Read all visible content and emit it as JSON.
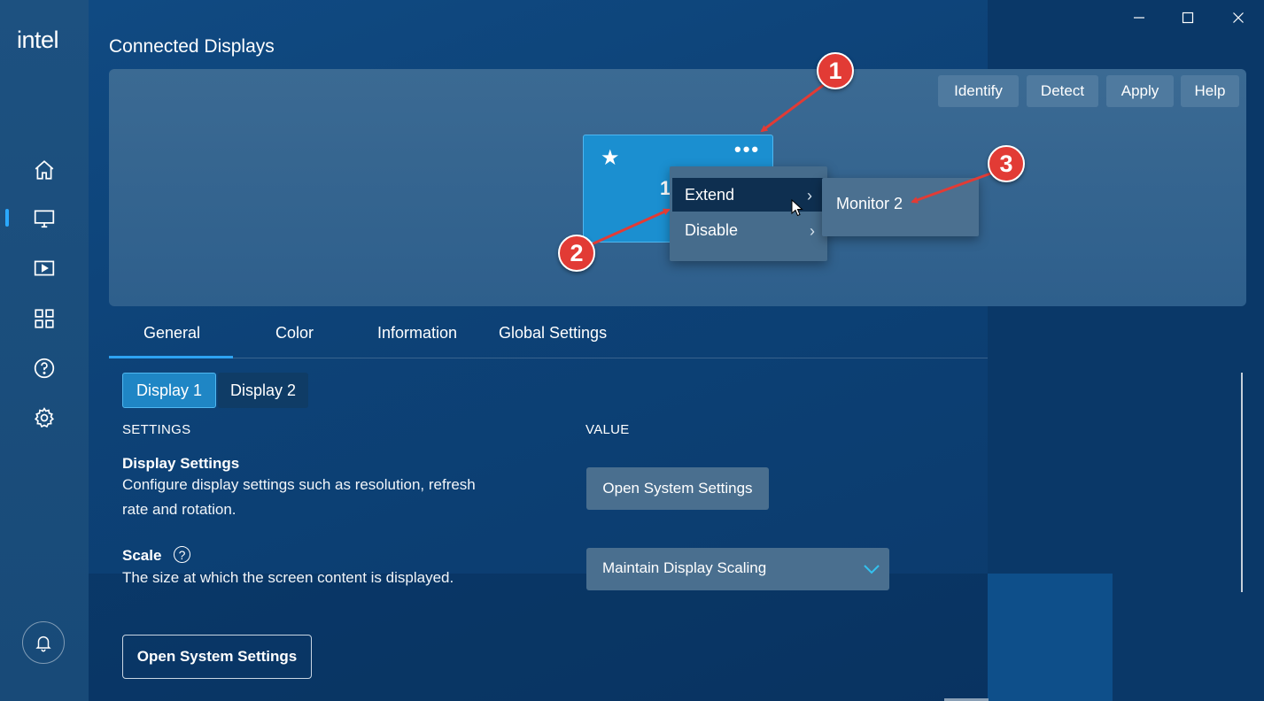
{
  "app": {
    "logo": "intel"
  },
  "window_controls": {
    "minimize": "—",
    "maximize": "☐",
    "close": "✕"
  },
  "page_title": "Connected Displays",
  "display_panel": {
    "buttons": {
      "identify": "Identify",
      "detect": "Detect",
      "apply": "Apply",
      "help": "Help"
    },
    "monitor": {
      "number": "1",
      "star": "★",
      "more": "•••"
    },
    "context_menu": {
      "items": [
        {
          "label": "Extend",
          "chevron": "›"
        },
        {
          "label": "Disable",
          "chevron": "›"
        }
      ],
      "submenu": {
        "item": "Monitor 2"
      }
    },
    "callouts": [
      "1",
      "2",
      "3"
    ]
  },
  "tabs": [
    "General",
    "Color",
    "Information",
    "Global Settings"
  ],
  "display_selector": [
    "Display 1",
    "Display 2"
  ],
  "columns": {
    "settings": "SETTINGS",
    "value": "VALUE"
  },
  "settings": {
    "display": {
      "title": "Display Settings",
      "desc_line1": "Configure display settings such as resolution, refresh",
      "desc_line2": "rate and rotation.",
      "button": "Open System Settings"
    },
    "scale": {
      "title": "Scale",
      "help": "?",
      "desc": "The size at which the screen content is displayed.",
      "dropdown_value": "Maintain Display Scaling"
    }
  },
  "footer_button": "Open System Settings",
  "colors": {
    "accent": "#2ea3f2",
    "callout": "#e23b35",
    "monitor": "#1b8fd0"
  }
}
